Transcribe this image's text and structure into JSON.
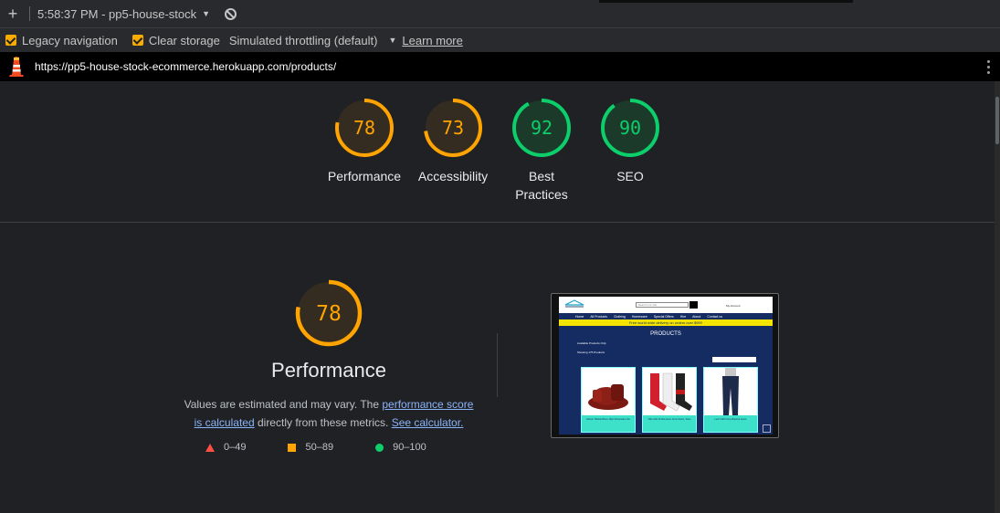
{
  "topbar": {
    "new_label": "+",
    "report_label": "5:58:37 PM - pp5-house-stock",
    "caret": "▼"
  },
  "settings": {
    "legacy_navigation": "Legacy navigation",
    "clear_storage": "Clear storage",
    "throttling": "Simulated throttling (default)",
    "caret": "▼",
    "learn_more": "Learn more"
  },
  "urlbar": {
    "url": "https://pp5-house-stock-ecommerce.herokuapp.com/products/"
  },
  "gauges": [
    {
      "label": "Performance",
      "score": "78",
      "value": 78,
      "color": "#ffa400"
    },
    {
      "label": "Accessibility",
      "score": "73",
      "value": 73,
      "color": "#ffa400"
    },
    {
      "label": "Best Practices",
      "score": "92",
      "value": 92,
      "color": "#0cce6b"
    },
    {
      "label": "SEO",
      "score": "90",
      "value": 90,
      "color": "#0cce6b"
    }
  ],
  "performance": {
    "score": "78",
    "value": 78,
    "title": "Performance",
    "desc_prefix": "Values are estimated and may vary. The ",
    "link1": "performance score is calculated",
    "desc_mid": " directly from these metrics. ",
    "link2": "See calculator.",
    "legend": [
      "0–49",
      "50–89",
      "90–100"
    ]
  },
  "colors": {
    "average": "#ffa400",
    "pass": "#0cce6b",
    "fail": "#ff4e42",
    "link": "#8ab4f8"
  },
  "site": {
    "search_placeholder": "Search our site",
    "account": "My Account",
    "nav": [
      "Home",
      "All Products",
      "Clothing",
      "Homeware",
      "Special Offers",
      "Hire",
      "About",
      "Contact us"
    ],
    "banner": "Free world wide delivery on orders over $99!!",
    "title": "PRODUCTS",
    "sub": "Available Products Only",
    "count": "Showing 175 Products",
    "cards": [
      "Gibson Hillside Blues 16pc Dinnerware Set",
      "Nike Kids Performance Crew Socks, Shoe",
      "Levi's 529 Curvy Bootcut Jeans"
    ]
  }
}
